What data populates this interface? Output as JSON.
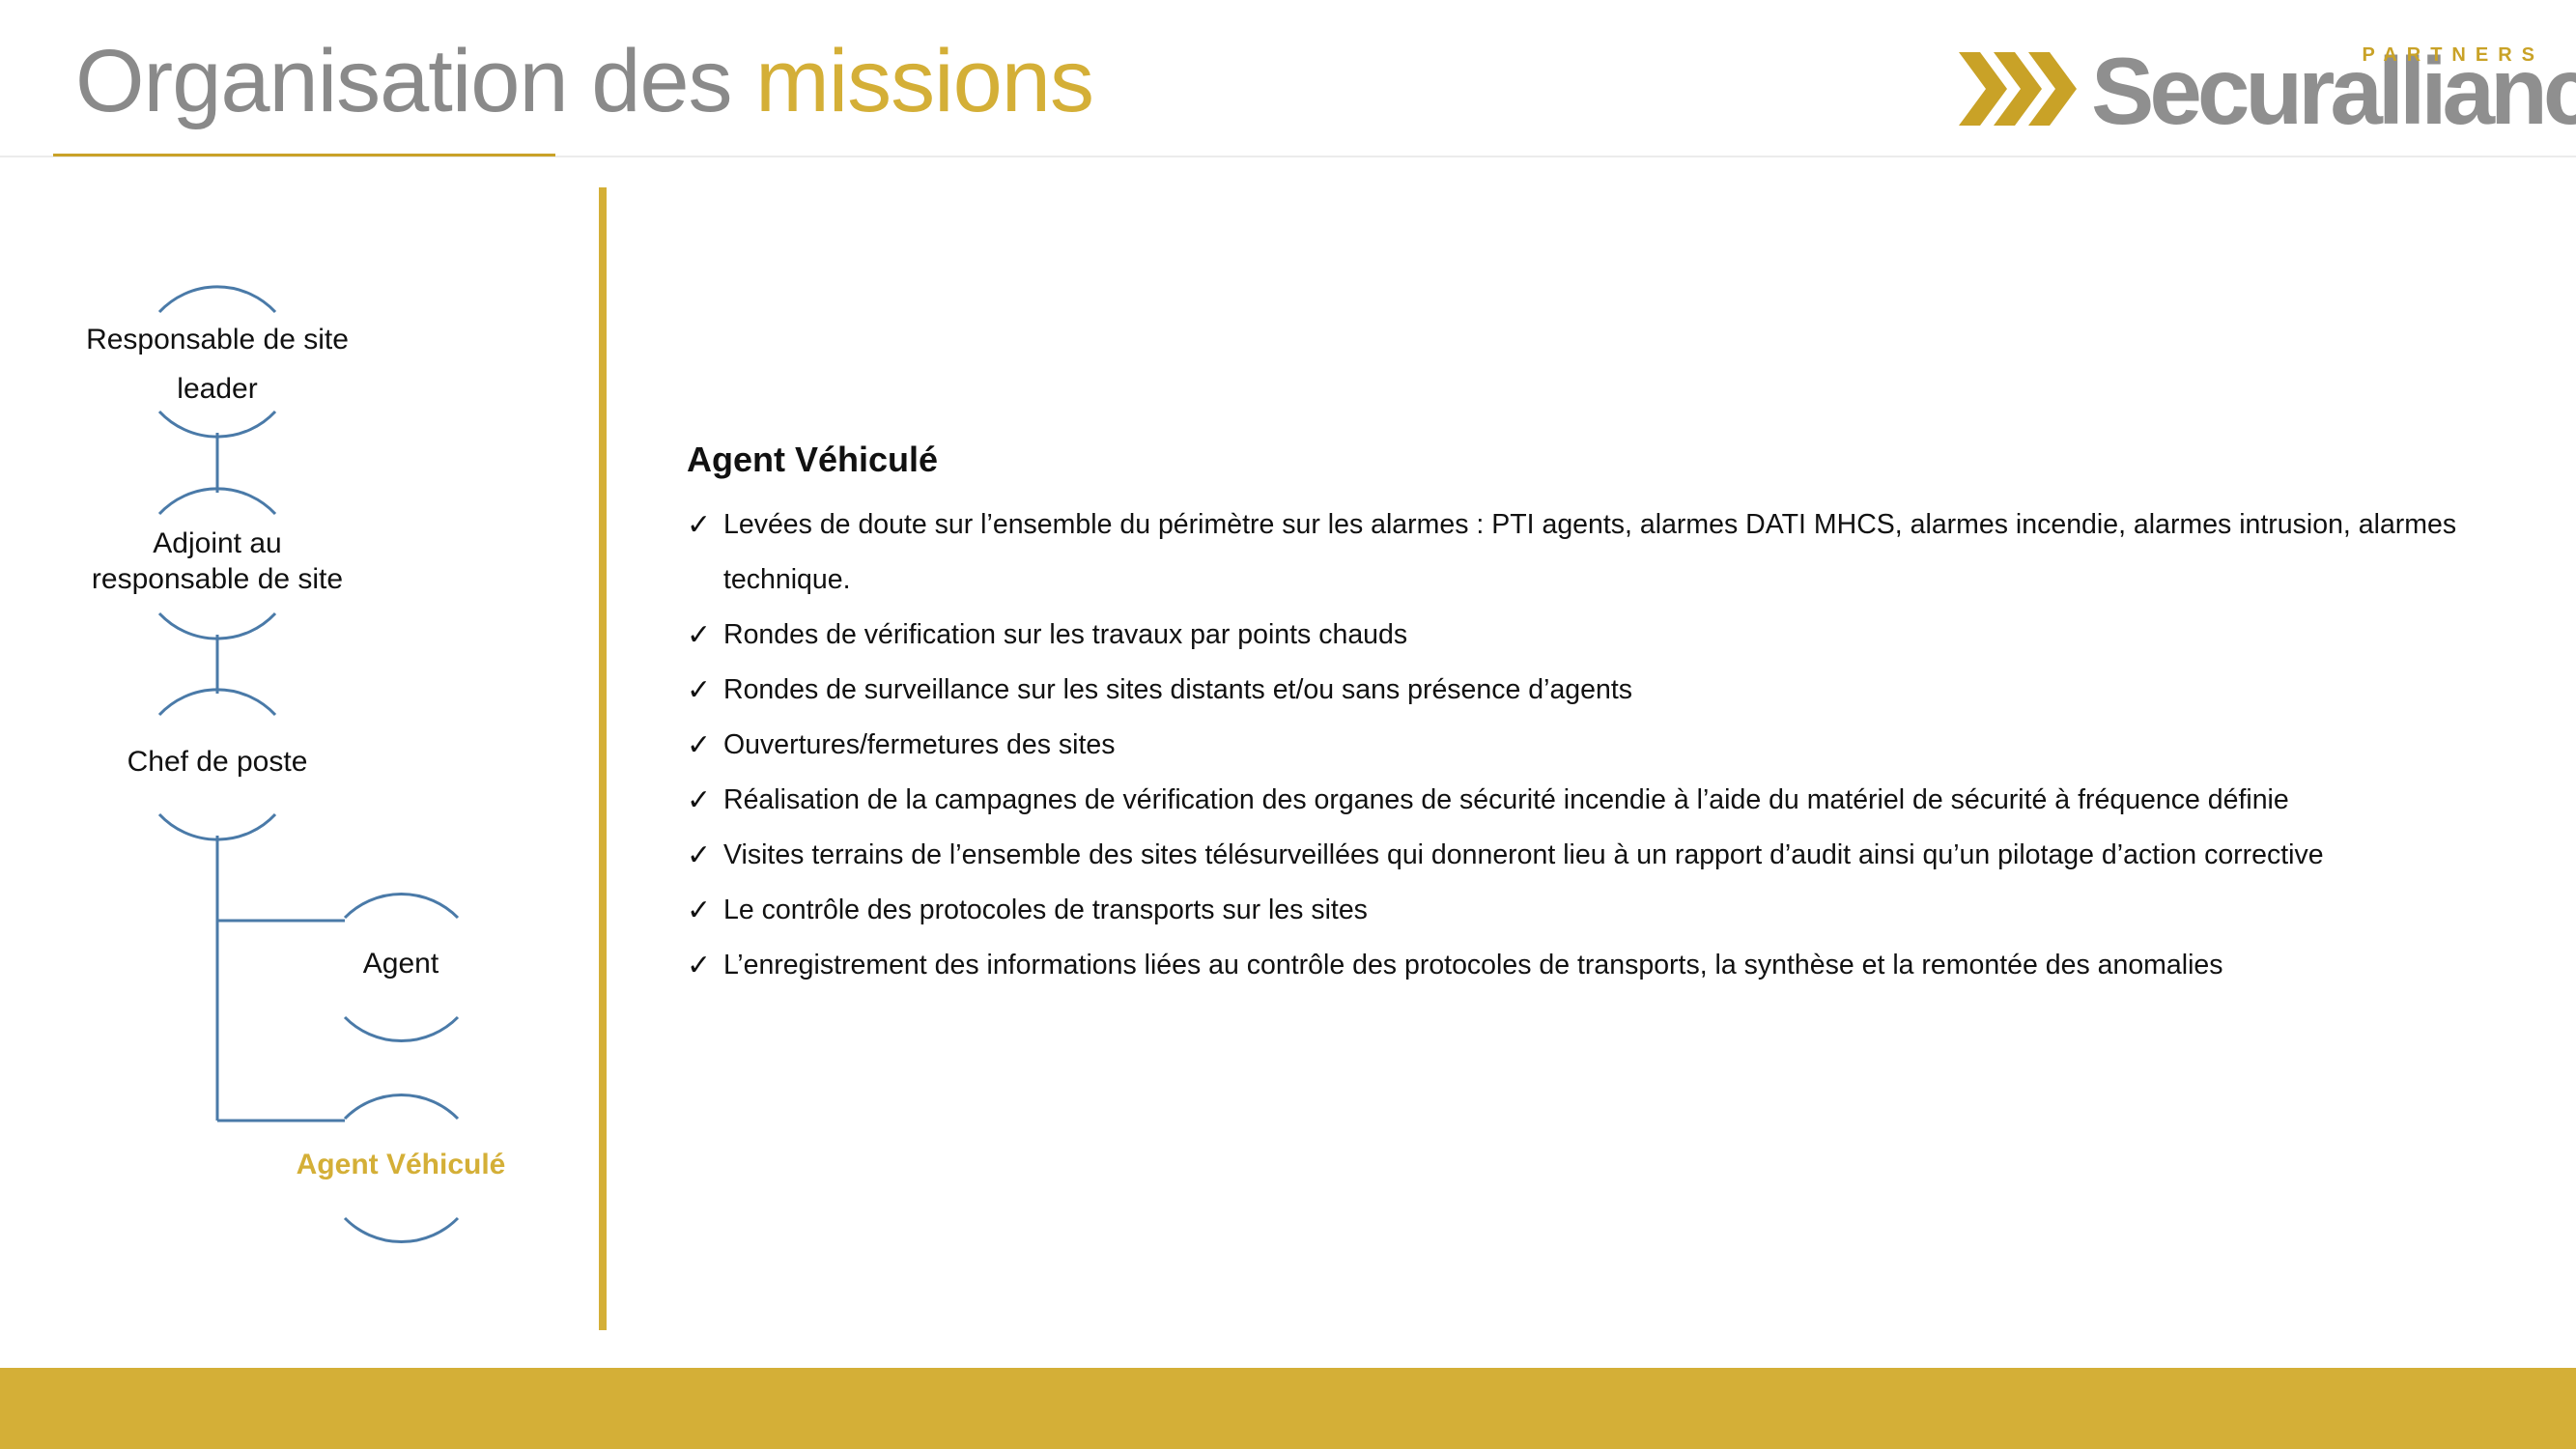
{
  "header": {
    "title_part1": "Organisation des ",
    "title_part2": "missions"
  },
  "logo": {
    "brand": "Securalliance",
    "partners": "PARTNERS",
    "icon": "triple-chevron-icon"
  },
  "colors": {
    "gold": "#d4af37",
    "grey_title": "#8a8a8a",
    "connector_blue": "#4a7aa8"
  },
  "org_chart": {
    "nodes": [
      {
        "id": "responsable",
        "line1": "Responsable de site",
        "line2": "leader"
      },
      {
        "id": "adjoint",
        "line1": "Adjoint au",
        "line2": "responsable de site"
      },
      {
        "id": "chef",
        "line1": "Chef de poste",
        "line2": ""
      },
      {
        "id": "agent",
        "line1": "Agent",
        "line2": ""
      },
      {
        "id": "agent_vehicule",
        "line1": "Agent Véhiculé",
        "line2": "",
        "active": true
      }
    ]
  },
  "content": {
    "heading": "Agent Véhiculé",
    "check_icon": "✓",
    "items": [
      "Levées de doute sur l’ensemble du périmètre sur les alarmes : PTI agents, alarmes DATI MHCS, alarmes incendie, alarmes intrusion, alarmes technique.",
      "Rondes de vérification sur les travaux par points chauds",
      "Rondes de surveillance sur les sites distants et/ou sans présence d’agents",
      "Ouvertures/fermetures des sites",
      "Réalisation de la campagnes de vérification des organes de sécurité incendie à l’aide du matériel de sécurité à fréquence définie",
      "Visites terrains de l’ensemble des sites télésurveillées qui donneront lieu à un rapport d’audit ainsi qu’un pilotage d’action corrective",
      "Le contrôle des protocoles de transports sur les sites",
      "L’enregistrement des informations liées au contrôle des protocoles de transports, la synthèse et la remontée des anomalies"
    ]
  }
}
